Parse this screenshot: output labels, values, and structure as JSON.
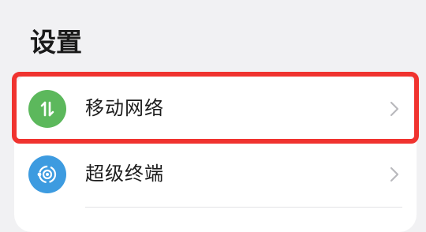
{
  "header": {
    "title": "设置"
  },
  "settings": {
    "items": [
      {
        "label": "移动网络",
        "icon": "mobile-data-arrows-icon",
        "icon_color": "#5cb85c"
      },
      {
        "label": "超级终端",
        "icon": "super-device-icon",
        "icon_color": "#3d9be0"
      }
    ]
  },
  "colors": {
    "page_background": "#f1f1f3",
    "card_background": "#ffffff",
    "highlight_border": "#f0332f",
    "chevron": "#b9b9bd"
  }
}
